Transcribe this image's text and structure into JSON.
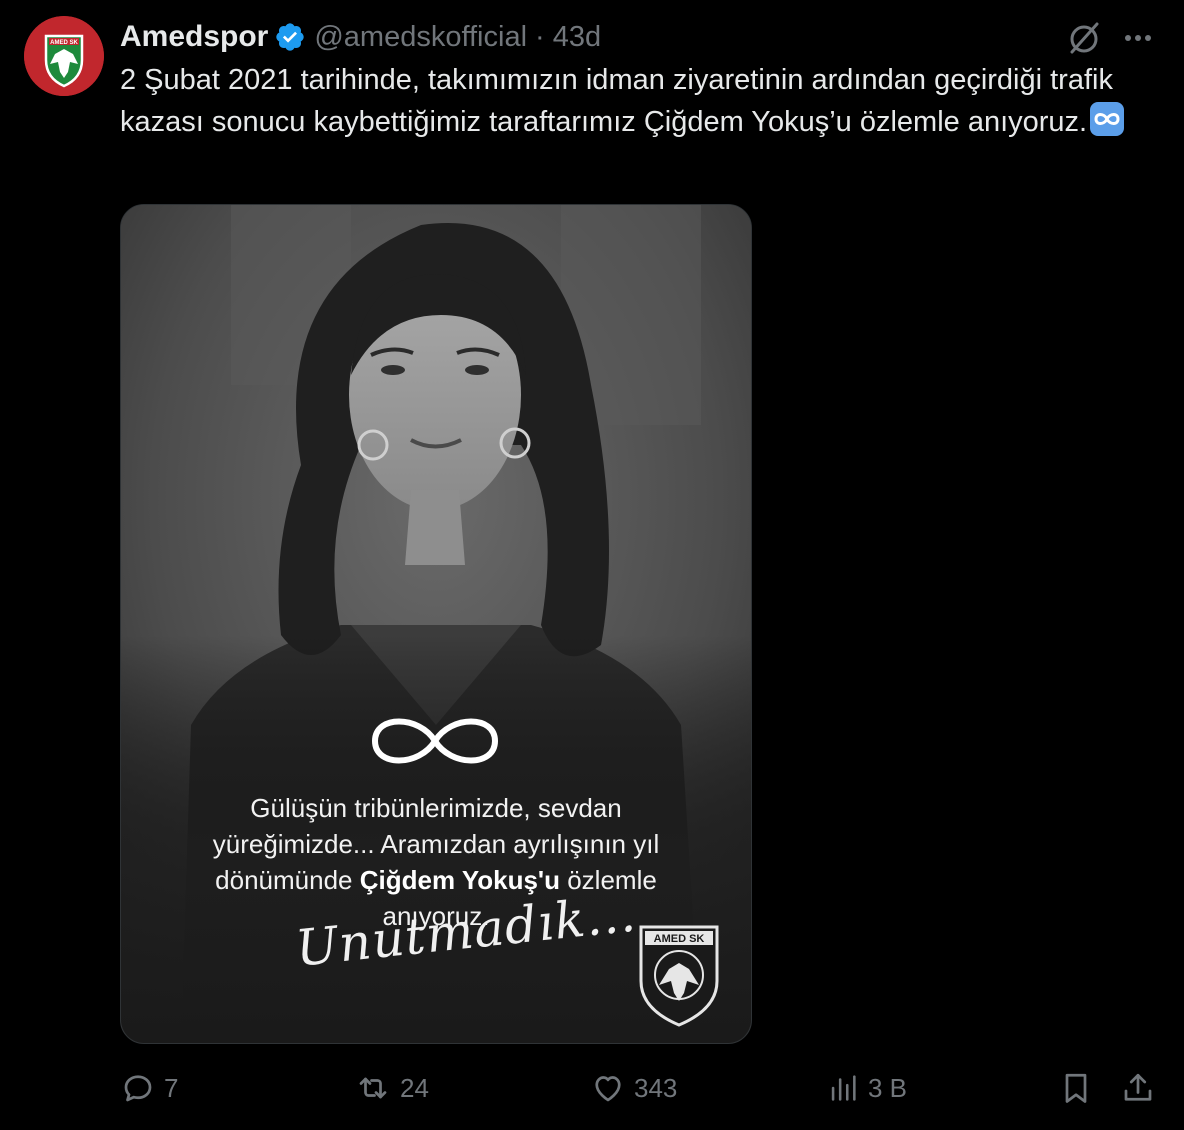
{
  "tweet": {
    "author": {
      "display_name": "Amedspor",
      "handle": "@amedskofficial",
      "verified": true,
      "avatar_badge_text": "AMED SK"
    },
    "separator": "·",
    "time": "43d",
    "text": "2 Şubat 2021 tarihinde, takımımızın idman ziyaretinin ardından geçirdiği trafik kazası sonucu kaybettiğimiz taraftarımız Çiğdem Yokuş’u özlemle anıyoruz.",
    "text_emoji": "infinity-emoji"
  },
  "media": {
    "poster": {
      "line1": "Gülüşün tribünlerimizde, sevdan",
      "line2": "yüreğimizde... Aramızdan ayrılışının yıl",
      "line3_pre": "dönümünde ",
      "line3_name": "Çiğdem Yokuş'u",
      "line3_post": " özlemle",
      "line4": "anıyoruz.",
      "signature": "Unutmadık...",
      "badge_text": "AMED SK"
    }
  },
  "actions": {
    "replies": "7",
    "reposts": "24",
    "likes": "343",
    "views": "3 B"
  },
  "colors": {
    "background": "#000000",
    "text": "#e7e9ea",
    "muted": "#71767b",
    "verified": "#1d9bf0",
    "avatar_red": "#c1272d",
    "avatar_green": "#1e8a3c"
  }
}
